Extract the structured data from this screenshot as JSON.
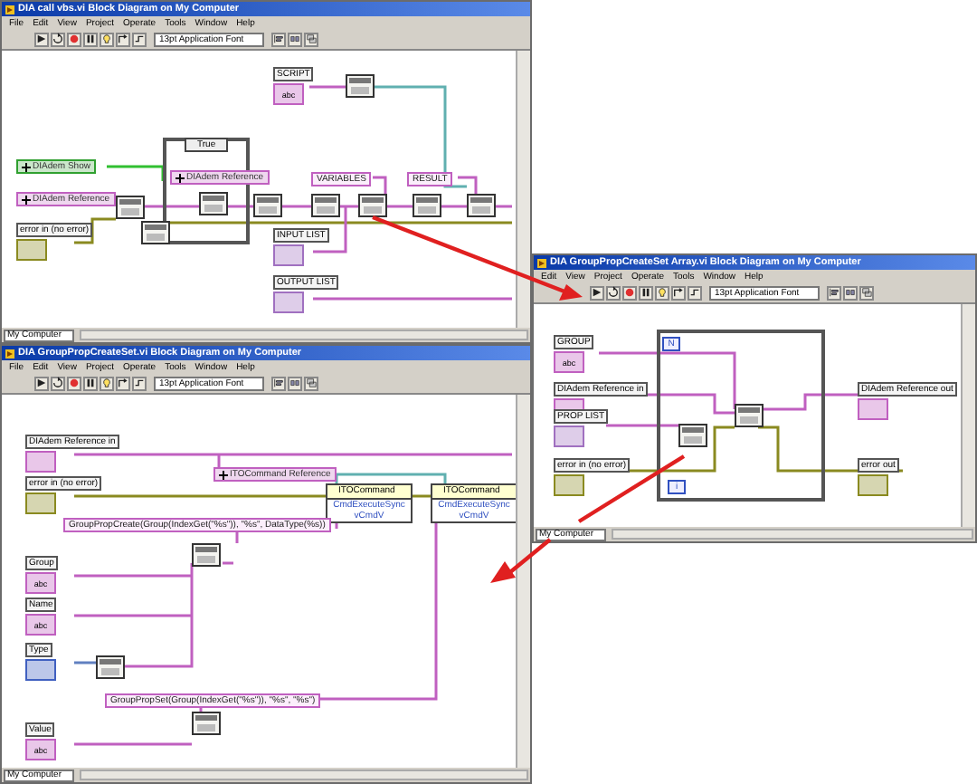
{
  "windows": [
    {
      "title": "DIA call vbs.vi Block Diagram on My Computer",
      "menu": [
        "File",
        "Edit",
        "View",
        "Project",
        "Operate",
        "Tools",
        "Window",
        "Help"
      ],
      "font": "13pt Application Font",
      "context": "My Computer",
      "nodes": [
        {
          "kind": "control",
          "label": "SCRIPT",
          "color": "#c060c0",
          "glyph": "abc"
        },
        {
          "kind": "constant",
          "label": "DIAdem Show",
          "color": "#30a030"
        },
        {
          "kind": "constant",
          "label": "DIAdem Reference",
          "color": "#c060c0"
        },
        {
          "kind": "control",
          "label": "error in (no error)",
          "color": "#8a8a20"
        },
        {
          "kind": "case",
          "selector": "True"
        },
        {
          "kind": "constant",
          "label": "DIAdem Reference",
          "color": "#c060c0"
        },
        {
          "kind": "string",
          "label": "VARIABLES"
        },
        {
          "kind": "string",
          "label": "RESULT"
        },
        {
          "kind": "control",
          "label": "INPUT LIST",
          "color": "#a070c0"
        },
        {
          "kind": "control",
          "label": "OUTPUT LIST",
          "color": "#a070c0"
        },
        {
          "kind": "subvi"
        },
        {
          "kind": "subvi"
        },
        {
          "kind": "subvi"
        },
        {
          "kind": "subvi"
        },
        {
          "kind": "subvi"
        },
        {
          "kind": "subvi"
        },
        {
          "kind": "subvi"
        },
        {
          "kind": "subvi"
        },
        {
          "kind": "subvi"
        }
      ]
    },
    {
      "title": "DIA GroupPropCreateSet Array.vi Block Diagram on My Computer",
      "menu": [
        "Edit",
        "View",
        "Project",
        "Operate",
        "Tools",
        "Window",
        "Help"
      ],
      "font": "13pt Application Font",
      "context": "My Computer",
      "nodes": [
        {
          "kind": "control",
          "label": "GROUP",
          "color": "#c060c0",
          "glyph": "abc"
        },
        {
          "kind": "control",
          "label": "DIAdem Reference in",
          "color": "#c060c0"
        },
        {
          "kind": "control",
          "label": "PROP LIST",
          "color": "#a070c0"
        },
        {
          "kind": "control",
          "label": "error in (no error)",
          "color": "#8a8a20"
        },
        {
          "kind": "loop",
          "count": "N",
          "index": "i"
        },
        {
          "kind": "subvi"
        },
        {
          "kind": "subvi"
        },
        {
          "kind": "control",
          "label": "DIAdem Reference out",
          "color": "#c060c0"
        },
        {
          "kind": "control",
          "label": "error out",
          "color": "#8a8a20"
        }
      ]
    },
    {
      "title": "DIA GroupPropCreateSet.vi Block Diagram on My Computer",
      "menu": [
        "File",
        "Edit",
        "View",
        "Project",
        "Operate",
        "Tools",
        "Window",
        "Help"
      ],
      "font": "13pt Application Font",
      "context": "My Computer",
      "nodes": [
        {
          "kind": "control",
          "label": "DIAdem Reference in",
          "color": "#c060c0"
        },
        {
          "kind": "control",
          "label": "error in (no error)",
          "color": "#8a8a20"
        },
        {
          "kind": "constant",
          "label": "ITOCommand Reference",
          "color": "#c060c0"
        },
        {
          "kind": "property",
          "label": "ITOCommand",
          "rows": [
            "CmdExecuteSync",
            "vCmdV"
          ]
        },
        {
          "kind": "property",
          "label": "ITOCommand",
          "rows": [
            "CmdExecuteSync",
            "vCmdV"
          ]
        },
        {
          "kind": "string",
          "label": "GroupPropCreate(Group(IndexGet(\"%s\")), \"%s\", DataType(%s))"
        },
        {
          "kind": "control",
          "label": "Group",
          "color": "#c060c0",
          "glyph": "abc"
        },
        {
          "kind": "control",
          "label": "Name",
          "color": "#c060c0",
          "glyph": "abc"
        },
        {
          "kind": "control",
          "label": "Type",
          "color": "#4060c0"
        },
        {
          "kind": "subvi"
        },
        {
          "kind": "string",
          "label": "GroupPropSet(Group(IndexGet(\"%s\")), \"%s\", \"%s\")"
        },
        {
          "kind": "control",
          "label": "Value",
          "color": "#c060c0",
          "glyph": "abc"
        },
        {
          "kind": "subvi"
        },
        {
          "kind": "subvi"
        }
      ]
    }
  ]
}
